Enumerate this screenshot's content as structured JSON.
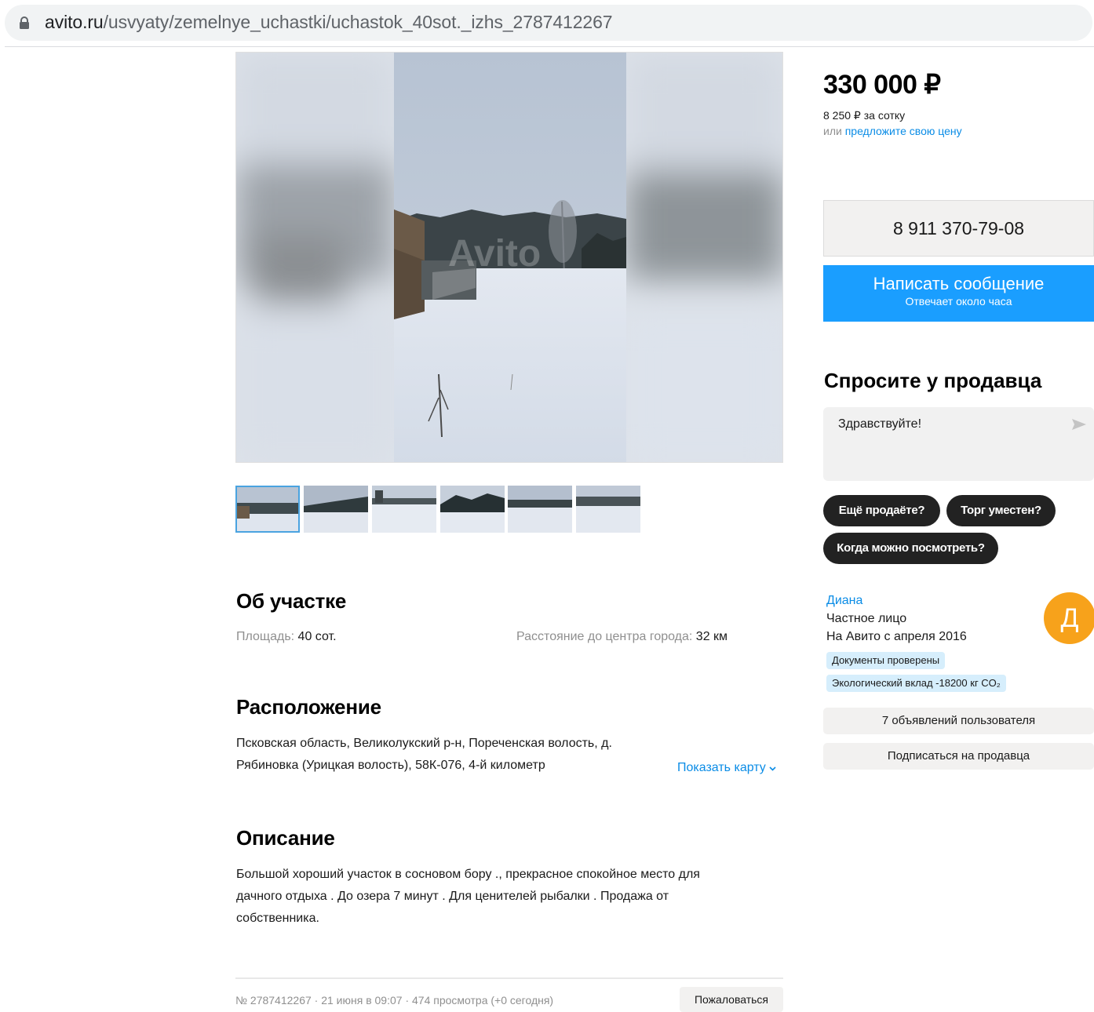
{
  "browser": {
    "url_host": "avito.ru",
    "url_path": "/usvyaty/zemelnye_uchastki/uchastok_40sot._izhs_2787412267"
  },
  "gallery": {
    "watermark": "Avito",
    "thumbnail_count": 6,
    "selected_index": 0
  },
  "about": {
    "title": "Об участке",
    "area_label": "Площадь:",
    "area_value": "40 сот.",
    "distance_label": "Расстояние до центра города:",
    "distance_value": "32 км"
  },
  "location": {
    "title": "Расположение",
    "address_line1": "Псковская область, Великолукский р-н, Пореченская волость, д.",
    "address_line2": "Рябиновка (Урицкая волость), 58К-076, 4-й километр",
    "show_map": "Показать карту"
  },
  "description": {
    "title": "Описание",
    "line1": "Большой хороший участок в сосновом бору ., прекрасное спокойное место для",
    "line2": "дачного отдыха . До озера 7 минут . Для ценителей рыбалки . Продажа от",
    "line3": "собственника."
  },
  "footer": {
    "meta": "№ 2787412267 · 21 июня в 09:07 · 474 просмотра (+0 сегодня)",
    "report": "Пожаловаться"
  },
  "sidebar": {
    "price": "330 000 ₽",
    "price_per": "8 250 ₽ за сотку",
    "offer_prefix": "или",
    "offer_link": "предложите свою цену",
    "phone": "8 911 370-79-08",
    "message_button": "Написать сообщение",
    "message_sub": "Отвечает около часа",
    "ask_title": "Спросите у продавца",
    "ask_text": "Здравствуйте!",
    "chips": [
      "Ещё продаёте?",
      "Торг уместен?",
      "Когда можно посмотреть?"
    ],
    "seller_name": "Диана",
    "seller_type": "Частное лицо",
    "seller_since": "На Авито с апреля 2016",
    "avatar_letter": "Д",
    "badge_docs": "Документы проверены",
    "badge_eco": "Экологический вклад -18200 кг CO₂",
    "ads_button": "7 объявлений пользователя",
    "subscribe_button": "Подписаться на продавца"
  },
  "colors": {
    "accent": "#1a9eff",
    "link": "#0a8ce6",
    "avatar": "#f7a21b",
    "chip": "#222222"
  }
}
